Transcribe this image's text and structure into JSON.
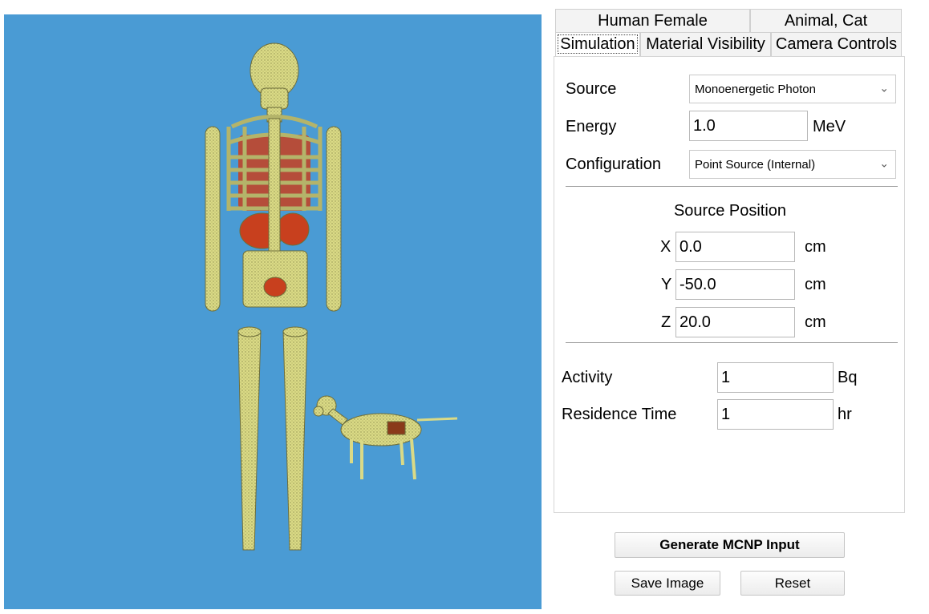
{
  "tabs_top": [
    {
      "label": "Human Female"
    },
    {
      "label": "Animal, Cat"
    }
  ],
  "tabs_bottom": [
    {
      "label": "Simulation",
      "active": true
    },
    {
      "label": "Material Visibility",
      "active": false
    },
    {
      "label": "Camera Controls",
      "active": false
    }
  ],
  "simulation": {
    "source_label": "Source",
    "source_value": "Monoenergetic Photon",
    "energy_label": "Energy",
    "energy_value": "1.0",
    "energy_unit": "MeV",
    "configuration_label": "Configuration",
    "configuration_value": "Point Source (Internal)",
    "source_position_heading": "Source Position",
    "position": [
      {
        "axis": "X",
        "value": "0.0",
        "unit": "cm"
      },
      {
        "axis": "Y",
        "value": "-50.0",
        "unit": "cm"
      },
      {
        "axis": "Z",
        "value": "20.0",
        "unit": "cm"
      }
    ],
    "activity_label": "Activity",
    "activity_value": "1",
    "activity_unit": "Bq",
    "residence_label": "Residence Time",
    "residence_value": "1",
    "residence_unit": "hr"
  },
  "buttons": {
    "generate": "Generate MCNP Input",
    "save_image": "Save Image",
    "reset": "Reset"
  },
  "colors": {
    "viewport_bg": "#4a9bd4",
    "bone": "#dada86",
    "organ": "#c8401e"
  },
  "icons": {
    "dropdown": "chevron-down-icon"
  }
}
